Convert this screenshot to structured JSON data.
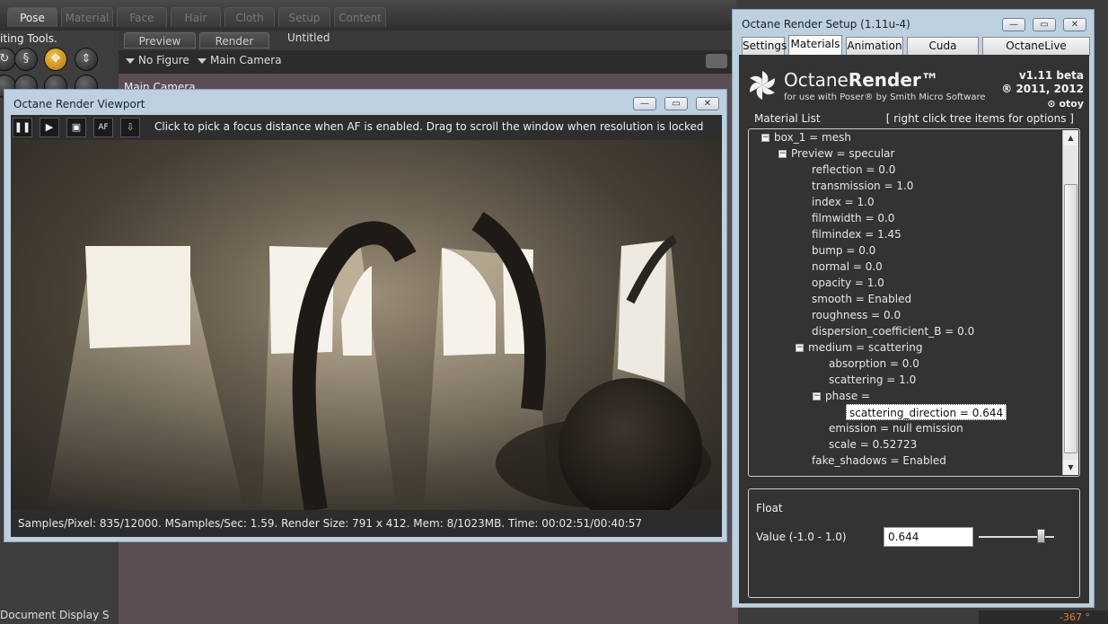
{
  "poser": {
    "tabs": [
      "Pose",
      "Material",
      "Face",
      "Hair",
      "Cloth",
      "Setup",
      "Content"
    ],
    "active_tab": "Pose",
    "editing_tools_label": "iting Tools.",
    "preview_tabs": [
      "Preview",
      "Render"
    ],
    "document_title": "Untitled",
    "figure_select": "No Figure",
    "camera_select": "Main Camera",
    "viewport_label": "Main Camera",
    "doc_display_label": "Document Display S",
    "rotation_readout": "-367 °"
  },
  "viewport": {
    "title": "Octane Render Viewport",
    "toolbar": {
      "pause_label": "❚❚",
      "play_label": "▶",
      "af_label": "AF",
      "hint": "Click to pick a focus distance when AF is enabled.  Drag to scroll the window when resolution is locked"
    },
    "status": "Samples/Pixel: 835/12000. MSamples/Sec: 1.59. Render Size: 791 x 412. Mem: 8/1023MB. Time: 00:02:51/00:40:57"
  },
  "setup": {
    "title": "Octane Render Setup (1.11u-4)",
    "tabs": [
      "Settings",
      "Materials",
      "Animation",
      "Cuda Devices",
      "OctaneLive Account"
    ],
    "active_tab": "Materials",
    "logo": {
      "name_a": "Octane",
      "name_b": "Render™",
      "subtitle": "for use with Poser® by Smith Micro Software",
      "version": "v1.11 beta",
      "year": "® 2011, 2012",
      "company": "otoy"
    },
    "material_list": {
      "title": "Material List",
      "hint": "[ right click tree items for options ]",
      "items": [
        {
          "label": "box_1 = mesh",
          "toggle": "−"
        },
        {
          "label": "Preview = specular",
          "toggle": "−"
        },
        {
          "label": "reflection = 0.0"
        },
        {
          "label": "transmission = 1.0"
        },
        {
          "label": "index = 1.0"
        },
        {
          "label": "filmwidth = 0.0"
        },
        {
          "label": "filmindex = 1.45"
        },
        {
          "label": "bump = 0.0"
        },
        {
          "label": "normal = 0.0"
        },
        {
          "label": "opacity = 1.0"
        },
        {
          "label": "smooth = Enabled"
        },
        {
          "label": "roughness = 0.0"
        },
        {
          "label": "dispersion_coefficient_B = 0.0"
        },
        {
          "label": "medium = scattering",
          "toggle": "−"
        },
        {
          "label": "absorption = 0.0"
        },
        {
          "label": "scattering = 1.0"
        },
        {
          "label": "phase =",
          "toggle": "−"
        },
        {
          "label": "scattering_direction = 0.644",
          "selected": true
        },
        {
          "label": "emission = null emission"
        },
        {
          "label": "scale = 0.52723"
        },
        {
          "label": "fake_shadows = Enabled"
        }
      ]
    },
    "float_panel": {
      "title": "Float",
      "value_label": "Value (-1.0 - 1.0)",
      "value": "0.644",
      "min": -1.0,
      "max": 1.0
    }
  },
  "colors": {
    "accent": "#f5c24a",
    "window_frame": "#bcd0e0",
    "panel_bg": "#333333"
  }
}
